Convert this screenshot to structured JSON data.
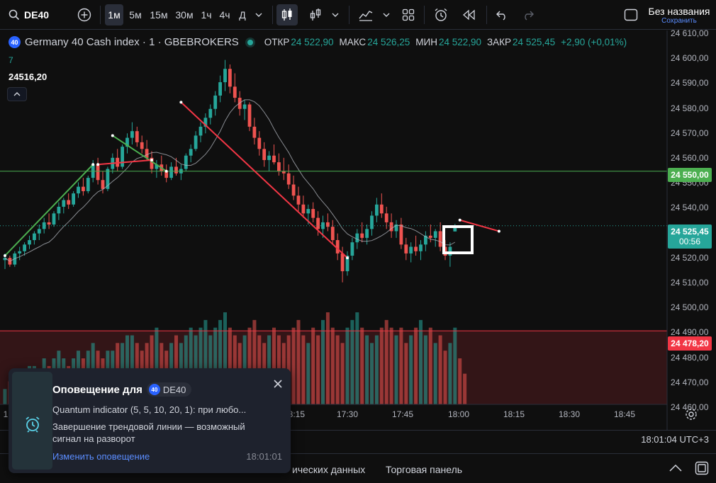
{
  "toolbar": {
    "symbol": "DE40",
    "intervals": [
      "1м",
      "5м",
      "15м",
      "30м",
      "1ч",
      "4ч",
      "Д"
    ],
    "active_interval": "1м",
    "layout_name": "Без названия",
    "save_status": "Сохранить"
  },
  "legend": {
    "instrument": "Germany 40 Cash index · 1 · GBEBROKERS",
    "badge": "40",
    "open_label": "ОТКР",
    "open": "24 522,90",
    "high_label": "МАКС",
    "high": "24 526,25",
    "low_label": "МИН",
    "low": "24 522,90",
    "close_label": "ЗАКР",
    "close": "24 525,45",
    "change": "+2,90 (+0,01%)",
    "indicator_value": "7",
    "cursor_price": "24516,20"
  },
  "price_axis": {
    "ticks": [
      "24 610,00",
      "24 600,00",
      "24 590,00",
      "24 580,00",
      "24 570,00",
      "24 560,00",
      "24 550,00",
      "24 540,00",
      "24 530,00",
      "24 520,00",
      "24 510,00",
      "24 500,00",
      "24 490,00",
      "24 480,00",
      "24 470,00",
      "24 460,00"
    ],
    "line_green": "24 550,00",
    "line_red": "24 478,20",
    "last_price": "24 525,45",
    "countdown": "00:56"
  },
  "time_axis": {
    "ticks": [
      "1",
      "18:15",
      "17:30",
      "17:45",
      "18:00",
      "18:15",
      "18:30",
      "18:45"
    ],
    "clock": "18:01:04 UTC+3"
  },
  "bottom_tabs": [
    "ических данных",
    "Торговая панель"
  ],
  "alert": {
    "title": "Оповещение для",
    "symbol_badge": "40",
    "symbol": "DE40",
    "condition": "Quantum indicator (5, 5, 10, 20, 1): при любо...",
    "message": "Завершение трендовой линии — возможный сигнал на разворот",
    "edit_link": "Изменить оповещение",
    "time": "18:01:01"
  },
  "colors": {
    "up": "#26a69a",
    "down": "#ef5350",
    "trend_down": "#f23645",
    "trend_up": "#4caf50",
    "accent": "#2962ff"
  },
  "chart_data": {
    "type": "candlestick",
    "interval": "1m",
    "ylim": [
      24455,
      24612
    ],
    "candles": [
      [
        24510,
        24513,
        24506,
        24511
      ],
      [
        24511,
        24512,
        24507,
        24508
      ],
      [
        24508,
        24514,
        24507,
        24513
      ],
      [
        24513,
        24516,
        24510,
        24514
      ],
      [
        24514,
        24518,
        24512,
        24517
      ],
      [
        24517,
        24521,
        24515,
        24519
      ],
      [
        24519,
        24523,
        24517,
        24522
      ],
      [
        24522,
        24526,
        24519,
        24524
      ],
      [
        24524,
        24529,
        24522,
        24527
      ],
      [
        24527,
        24531,
        24524,
        24526
      ],
      [
        24526,
        24532,
        24525,
        24531
      ],
      [
        24531,
        24536,
        24528,
        24534
      ],
      [
        24534,
        24538,
        24531,
        24537
      ],
      [
        24537,
        24540,
        24533,
        24535
      ],
      [
        24535,
        24541,
        24534,
        24540
      ],
      [
        24540,
        24545,
        24538,
        24543
      ],
      [
        24543,
        24547,
        24539,
        24541
      ],
      [
        24541,
        24548,
        24540,
        24547
      ],
      [
        24547,
        24555,
        24545,
        24553
      ],
      [
        24553,
        24556,
        24544,
        24546
      ],
      [
        24546,
        24550,
        24540,
        24542
      ],
      [
        24542,
        24552,
        24541,
        24551
      ],
      [
        24551,
        24558,
        24549,
        24556
      ],
      [
        24556,
        24560,
        24550,
        24552
      ],
      [
        24552,
        24562,
        24551,
        24561
      ],
      [
        24561,
        24567,
        24558,
        24565
      ],
      [
        24565,
        24572,
        24562,
        24568
      ],
      [
        24568,
        24570,
        24561,
        24563
      ],
      [
        24563,
        24566,
        24558,
        24560
      ],
      [
        24560,
        24564,
        24555,
        24556
      ],
      [
        24556,
        24559,
        24549,
        24551
      ],
      [
        24551,
        24555,
        24547,
        24553
      ],
      [
        24553,
        24557,
        24548,
        24550
      ],
      [
        24550,
        24553,
        24545,
        24547
      ],
      [
        24547,
        24554,
        24546,
        24552
      ],
      [
        24552,
        24556,
        24548,
        24549
      ],
      [
        24549,
        24553,
        24546,
        24551
      ],
      [
        24551,
        24558,
        24550,
        24557
      ],
      [
        24557,
        24562,
        24554,
        24560
      ],
      [
        24560,
        24568,
        24559,
        24566
      ],
      [
        24566,
        24572,
        24563,
        24570
      ],
      [
        24570,
        24576,
        24567,
        24574
      ],
      [
        24574,
        24580,
        24571,
        24578
      ],
      [
        24578,
        24586,
        24575,
        24584
      ],
      [
        24584,
        24593,
        24581,
        24590
      ],
      [
        24590,
        24600,
        24586,
        24596
      ],
      [
        24596,
        24598,
        24585,
        24588
      ],
      [
        24588,
        24594,
        24581,
        24583
      ],
      [
        24583,
        24586,
        24575,
        24578
      ],
      [
        24578,
        24582,
        24573,
        24580
      ],
      [
        24580,
        24581,
        24568,
        24570
      ],
      [
        24570,
        24574,
        24562,
        24565
      ],
      [
        24565,
        24568,
        24557,
        24560
      ],
      [
        24560,
        24563,
        24552,
        24555
      ],
      [
        24555,
        24559,
        24550,
        24557
      ],
      [
        24557,
        24562,
        24553,
        24554
      ],
      [
        24554,
        24558,
        24548,
        24550
      ],
      [
        24550,
        24556,
        24546,
        24549
      ],
      [
        24549,
        24553,
        24542,
        24544
      ],
      [
        24544,
        24548,
        24537,
        24539
      ],
      [
        24539,
        24543,
        24532,
        24535
      ],
      [
        24535,
        24539,
        24529,
        24531
      ],
      [
        24531,
        24535,
        24526,
        24533
      ],
      [
        24533,
        24536,
        24527,
        24529
      ],
      [
        24529,
        24532,
        24521,
        24524
      ],
      [
        24524,
        24530,
        24520,
        24527
      ],
      [
        24527,
        24531,
        24523,
        24525
      ],
      [
        24525,
        24528,
        24517,
        24519
      ],
      [
        24519,
        24522,
        24510,
        24513
      ],
      [
        24513,
        24516,
        24500,
        24505
      ],
      [
        24505,
        24514,
        24503,
        24512
      ],
      [
        24512,
        24520,
        24510,
        24518
      ],
      [
        24518,
        24524,
        24515,
        24522
      ],
      [
        24522,
        24527,
        24518,
        24520
      ],
      [
        24520,
        24526,
        24517,
        24524
      ],
      [
        24524,
        24532,
        24521,
        24530
      ],
      [
        24530,
        24538,
        24527,
        24535
      ],
      [
        24535,
        24540,
        24529,
        24531
      ],
      [
        24531,
        24534,
        24524,
        24527
      ],
      [
        24527,
        24531,
        24520,
        24523
      ],
      [
        24523,
        24528,
        24520,
        24526
      ],
      [
        24526,
        24529,
        24515,
        24517
      ],
      [
        24517,
        24520,
        24510,
        24513
      ],
      [
        24513,
        24518,
        24509,
        24516
      ],
      [
        24516,
        24521,
        24512,
        24514
      ],
      [
        24514,
        24519,
        24510,
        24517
      ],
      [
        24517,
        24523,
        24514,
        24521
      ],
      [
        24521,
        24526,
        24518,
        24520
      ],
      [
        24520,
        24524,
        24516,
        24523
      ],
      [
        24523,
        24527,
        24514,
        24516
      ],
      [
        24516,
        24519,
        24510,
        24512
      ],
      [
        24512,
        24518,
        24507,
        24516
      ],
      [
        24522.9,
        24526.25,
        24522.9,
        24525.45
      ]
    ],
    "volume": [
      2,
      3,
      3,
      4,
      4,
      5,
      5,
      4,
      6,
      5,
      6,
      7,
      6,
      5,
      6,
      7,
      6,
      7,
      8,
      7,
      6,
      7,
      7,
      8,
      8,
      9,
      9,
      8,
      7,
      8,
      9,
      10,
      8,
      7,
      8,
      9,
      8,
      9,
      10,
      9,
      10,
      11,
      9,
      10,
      11,
      12,
      10,
      9,
      8,
      9,
      10,
      11,
      9,
      8,
      9,
      10,
      9,
      8,
      9,
      10,
      11,
      9,
      8,
      10,
      9,
      11,
      12,
      10,
      9,
      8,
      10,
      11,
      12,
      10,
      9,
      8,
      9,
      10,
      11,
      10,
      9,
      10,
      8,
      9,
      10,
      11,
      9,
      10,
      8,
      9,
      7,
      8,
      10,
      6,
      4
    ],
    "moving_average": "shown",
    "overlays": {
      "horizontal_green": 24550.0,
      "horizontal_red": 24478.2,
      "last_price_line": 24525.45,
      "trend_up_segments": [
        [
          0,
          24512,
          18,
          24553
        ]
      ],
      "trend_down_segments": [
        [
          36,
          24581,
          70,
          24511
        ],
        [
          93,
          24528,
          101,
          24523
        ]
      ],
      "trend_misc": [
        [
          22,
          24566,
          33,
          24550
        ],
        [
          19,
          24553,
          30,
          24555
        ]
      ]
    },
    "x_tick_labels": [
      "17:15",
      "17:30",
      "17:45",
      "18:00",
      "18:15",
      "18:30",
      "18:45"
    ]
  }
}
